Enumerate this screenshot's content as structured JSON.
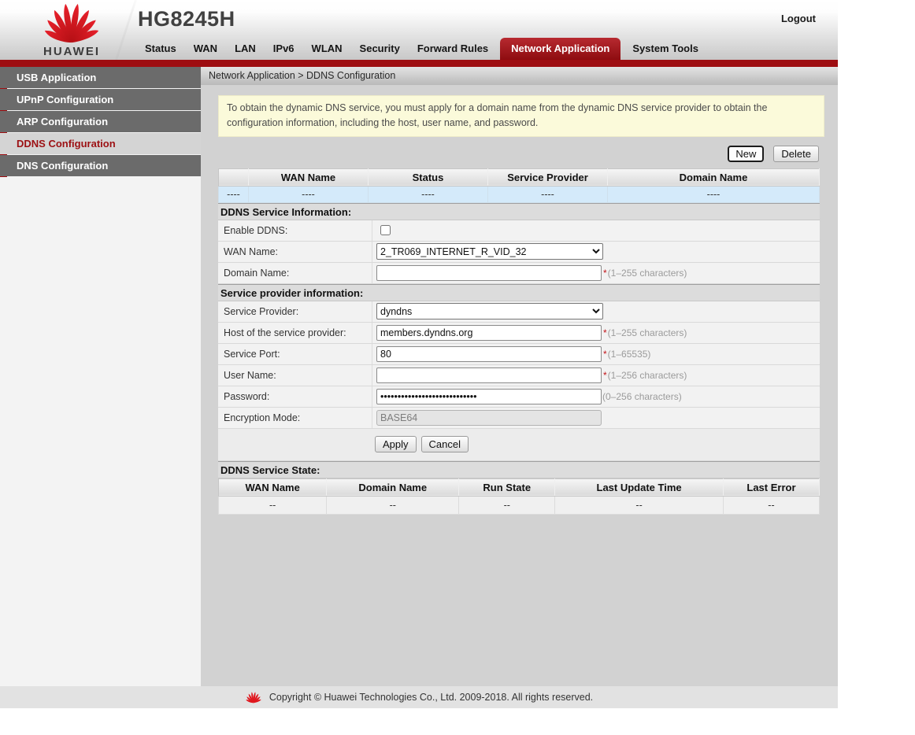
{
  "header": {
    "brand": "HUAWEI",
    "model": "HG8245H",
    "logout_label": "Logout",
    "nav": [
      {
        "label": "Status",
        "active": false
      },
      {
        "label": "WAN",
        "active": false
      },
      {
        "label": "LAN",
        "active": false
      },
      {
        "label": "IPv6",
        "active": false
      },
      {
        "label": "WLAN",
        "active": false
      },
      {
        "label": "Security",
        "active": false
      },
      {
        "label": "Forward Rules",
        "active": false
      },
      {
        "label": "Network Application",
        "active": true
      },
      {
        "label": "System Tools",
        "active": false
      }
    ]
  },
  "sidebar": {
    "items": [
      {
        "label": "USB Application",
        "active": false
      },
      {
        "label": "UPnP Configuration",
        "active": false
      },
      {
        "label": "ARP Configuration",
        "active": false
      },
      {
        "label": "DDNS Configuration",
        "active": true
      },
      {
        "label": "DNS Configuration",
        "active": false
      }
    ]
  },
  "breadcrumb": "Network Application > DDNS Configuration",
  "note": "To obtain the dynamic DNS service, you must apply for a domain name from the dynamic DNS service provider to obtain the configuration information, including the host, user name, and password.",
  "actions": {
    "new_label": "New",
    "delete_label": "Delete"
  },
  "ddns_table": {
    "headers": [
      "",
      "WAN Name",
      "Status",
      "Service Provider",
      "Domain Name"
    ],
    "rows": [
      [
        "----",
        "----",
        "----",
        "----",
        "----"
      ]
    ]
  },
  "service_info": {
    "title": "DDNS Service Information:",
    "enable_label": "Enable DDNS:",
    "wan_name_label": "WAN Name:",
    "wan_name_value": "2_TR069_INTERNET_R_VID_32",
    "domain_label": "Domain Name:",
    "domain_value": "",
    "domain_required": "*",
    "domain_hint": "(1–255 characters)"
  },
  "provider_info": {
    "title": "Service provider information:",
    "provider_label": "Service Provider:",
    "provider_value": "dyndns",
    "host_label": "Host of the service provider:",
    "host_value": "members.dyndns.org",
    "host_required": "*",
    "host_hint": "(1–255 characters)",
    "port_label": "Service Port:",
    "port_value": "80",
    "port_required": "*",
    "port_hint": "(1–65535)",
    "user_label": "User Name:",
    "user_value": "",
    "user_required": "*",
    "user_hint": "(1–256 characters)",
    "password_label": "Password:",
    "password_value": "••••••••••••••••••••••••••••",
    "password_hint": "(0–256 characters)",
    "encryption_label": "Encryption Mode:",
    "encryption_value": "BASE64"
  },
  "form_buttons": {
    "apply_label": "Apply",
    "cancel_label": "Cancel"
  },
  "service_state": {
    "title": "DDNS Service State:",
    "headers": [
      "WAN Name",
      "Domain Name",
      "Run State",
      "Last Update Time",
      "Last Error"
    ],
    "rows": [
      [
        "--",
        "--",
        "--",
        "--",
        "--"
      ]
    ]
  },
  "footer": {
    "copyright": "Copyright © Huawei Technologies Co., Ltd. 2009-2018. All rights reserved."
  },
  "colors": {
    "brand_red": "#9e0d11",
    "active_tab_red": "#a01318",
    "highlight_row_blue": "#d4eafa",
    "note_bg": "#fbfada",
    "sidebar_item_gray": "#6b6b6b"
  }
}
